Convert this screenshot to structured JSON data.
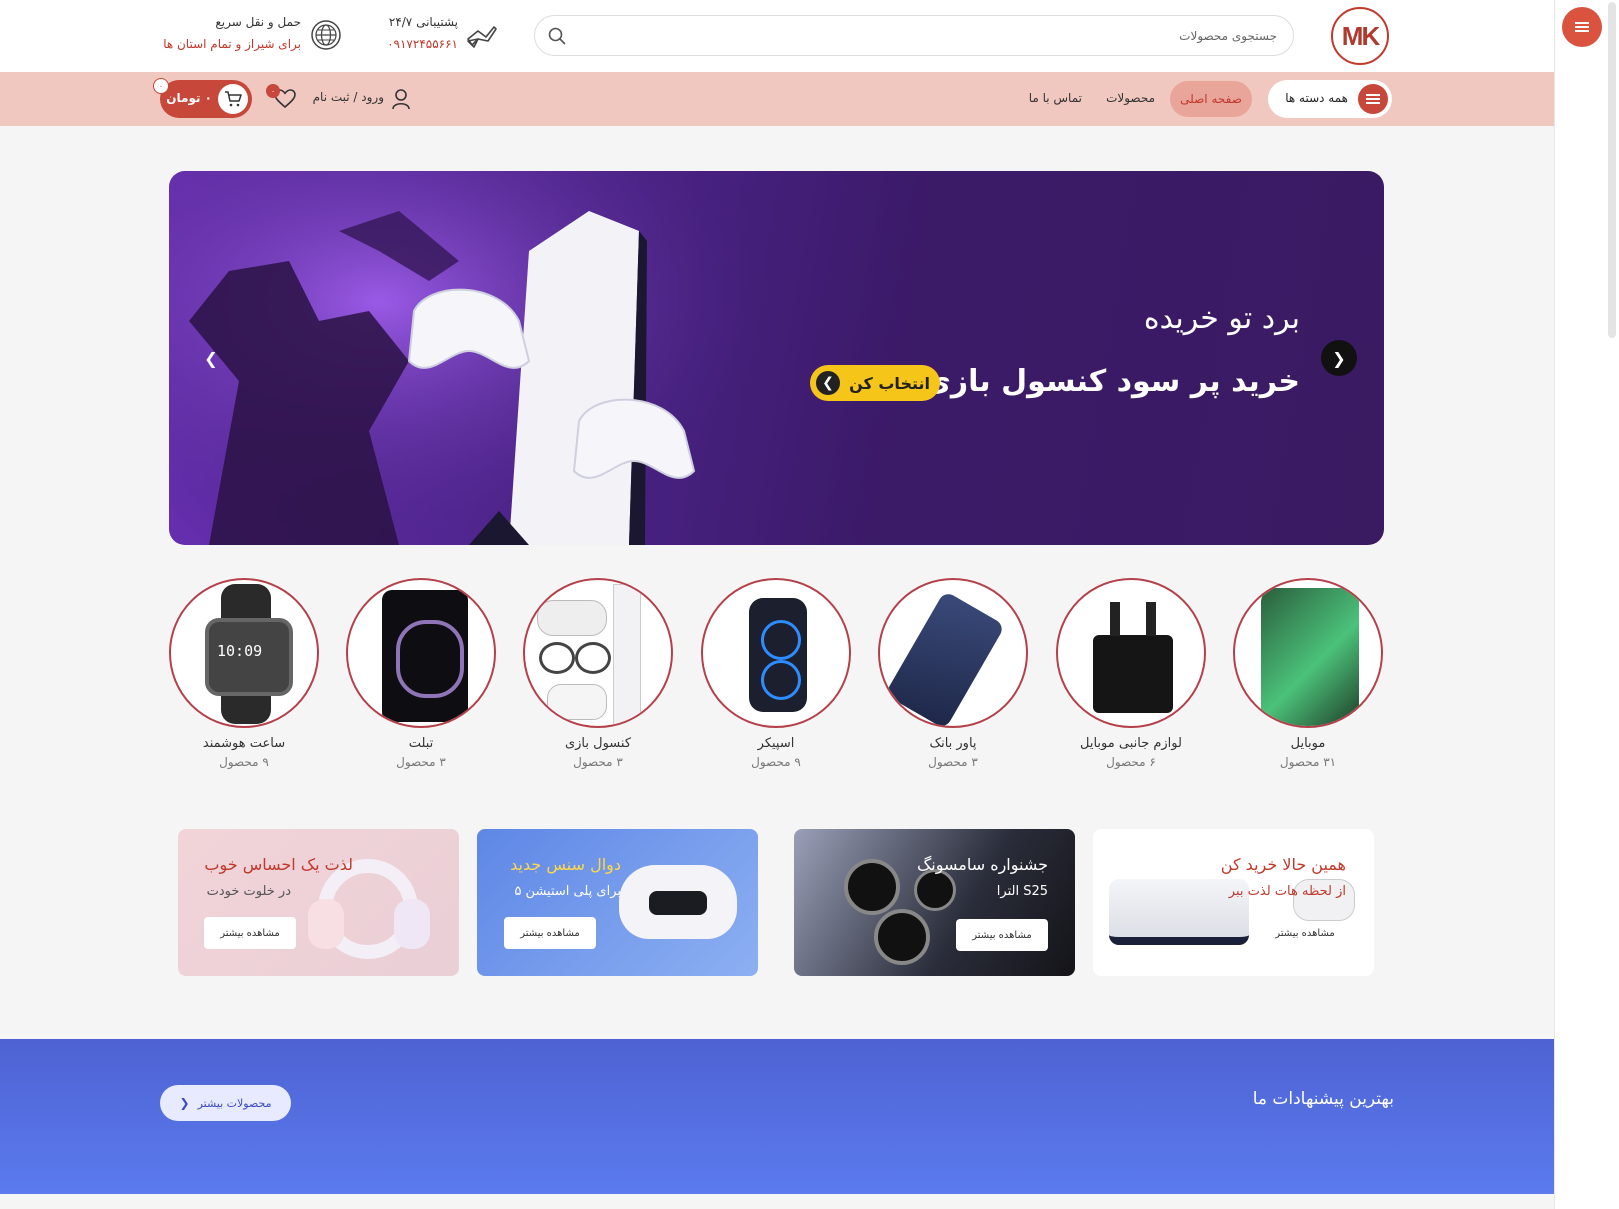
{
  "header": {
    "logo_text": "MK",
    "search_placeholder": "جستجوی محصولات",
    "support_title": "پشتیبانی ۲۴/۷",
    "support_phone": "۰۹۱۷۲۴۵۵۶۶۱",
    "shipping_title": "حمل و نقل سریع",
    "shipping_sub": "برای شیراز و تمام استان ها"
  },
  "nav": {
    "all_categories": "همه دسته ها",
    "home": "صفحه اصلی",
    "products": "محصولات",
    "contact": "تماس با ما",
    "login": "ورود / ثبت نام",
    "wishlist_count": "۰",
    "cart_total": "۰ تومان",
    "cart_count": "۰"
  },
  "hero": {
    "line1": "برد تو خریده",
    "line2": "خرید پر سود کنسول بازی",
    "button": "انتخاب کن"
  },
  "categories": [
    {
      "name": "موبایل",
      "count": "۳۱ محصول",
      "icon": "phone-image"
    },
    {
      "name": "لوازم جانبی موبایل",
      "count": "۶ محصول",
      "icon": "charger-image"
    },
    {
      "name": "پاور بانک",
      "count": "۳ محصول",
      "icon": "powerbank-image"
    },
    {
      "name": "اسپیکر",
      "count": "۹ محصول",
      "icon": "speaker-image"
    },
    {
      "name": "کنسول بازی",
      "count": "۳ محصول",
      "icon": "console-image"
    },
    {
      "name": "تبلت",
      "count": "۳ محصول",
      "icon": "tablet-image"
    },
    {
      "name": "ساعت هوشمند",
      "count": "۹ محصول",
      "icon": "watch-image"
    }
  ],
  "promos": [
    {
      "title": "همین حالا خرید کن",
      "subtitle": "از لحظه هات لذت ببر",
      "button": "مشاهده بیشتر"
    },
    {
      "title": "جشنواره سامسونگ",
      "subtitle": "S25 الترا",
      "button": "مشاهده بیشتر"
    },
    {
      "title": "دوال سنس جدید",
      "subtitle": "برای پلی استیشن ۵",
      "button": "مشاهده بیشتر"
    },
    {
      "title": "لذت یک احساس خوب",
      "subtitle": "در خلوت خودت",
      "button": "مشاهده بیشتر"
    }
  ],
  "offers": {
    "title": "بهترین پیشنهادات ما",
    "more_button": "محصولات بیشتر"
  },
  "colors": {
    "brand": "#c7473a",
    "nav_bg": "#f0c8c0",
    "offers_bg": "#5066d8"
  }
}
